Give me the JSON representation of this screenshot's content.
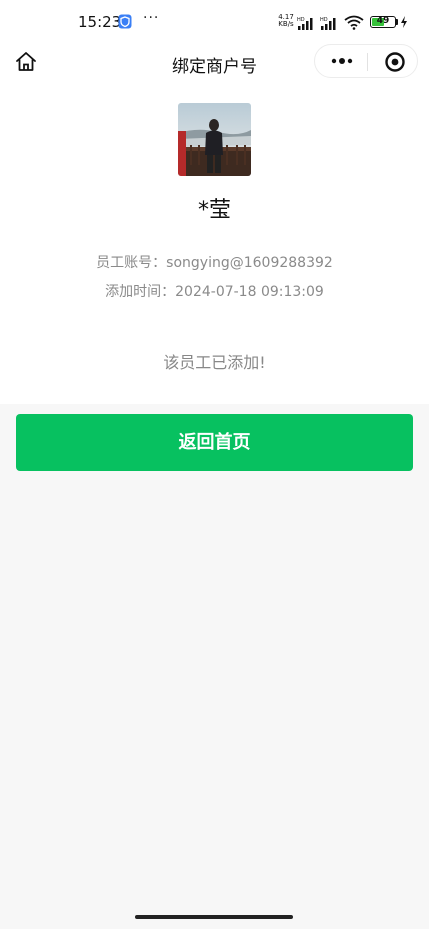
{
  "status_bar": {
    "time": "15:23",
    "more": "···",
    "net_speed_value": "4.17",
    "net_speed_unit": "KB/s",
    "battery_level": "49",
    "colors": {
      "battery": "#36c23a",
      "shield": "#3a7ff6"
    }
  },
  "nav": {
    "title": "绑定商户号",
    "icons": {
      "home": "home-icon",
      "more": "more-dots-icon",
      "close": "target-circle-icon"
    }
  },
  "profile": {
    "name": "*莹",
    "account": "员工账号：songying@1609288392",
    "added_time": "添加时间：2024-07-18 09:13:09",
    "status_message": "该员工已添加!"
  },
  "actions": {
    "back_label": "返回首页",
    "accent_color": "#07c160"
  }
}
